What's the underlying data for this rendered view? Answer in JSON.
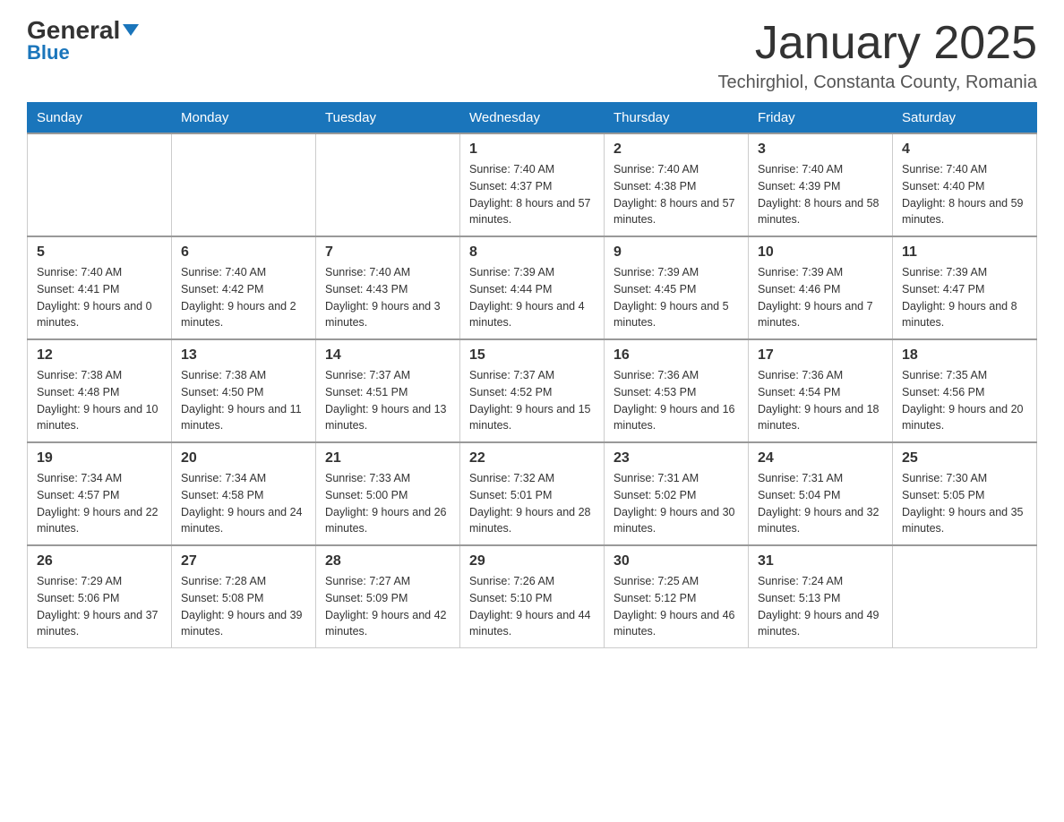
{
  "logo": {
    "general": "General",
    "blue": "Blue",
    "arrow": "▼"
  },
  "title": "January 2025",
  "subtitle": "Techirghiol, Constanta County, Romania",
  "days_of_week": [
    "Sunday",
    "Monday",
    "Tuesday",
    "Wednesday",
    "Thursday",
    "Friday",
    "Saturday"
  ],
  "weeks": [
    [
      {
        "day": "",
        "info": ""
      },
      {
        "day": "",
        "info": ""
      },
      {
        "day": "",
        "info": ""
      },
      {
        "day": "1",
        "info": "Sunrise: 7:40 AM\nSunset: 4:37 PM\nDaylight: 8 hours\nand 57 minutes."
      },
      {
        "day": "2",
        "info": "Sunrise: 7:40 AM\nSunset: 4:38 PM\nDaylight: 8 hours\nand 57 minutes."
      },
      {
        "day": "3",
        "info": "Sunrise: 7:40 AM\nSunset: 4:39 PM\nDaylight: 8 hours\nand 58 minutes."
      },
      {
        "day": "4",
        "info": "Sunrise: 7:40 AM\nSunset: 4:40 PM\nDaylight: 8 hours\nand 59 minutes."
      }
    ],
    [
      {
        "day": "5",
        "info": "Sunrise: 7:40 AM\nSunset: 4:41 PM\nDaylight: 9 hours\nand 0 minutes."
      },
      {
        "day": "6",
        "info": "Sunrise: 7:40 AM\nSunset: 4:42 PM\nDaylight: 9 hours\nand 2 minutes."
      },
      {
        "day": "7",
        "info": "Sunrise: 7:40 AM\nSunset: 4:43 PM\nDaylight: 9 hours\nand 3 minutes."
      },
      {
        "day": "8",
        "info": "Sunrise: 7:39 AM\nSunset: 4:44 PM\nDaylight: 9 hours\nand 4 minutes."
      },
      {
        "day": "9",
        "info": "Sunrise: 7:39 AM\nSunset: 4:45 PM\nDaylight: 9 hours\nand 5 minutes."
      },
      {
        "day": "10",
        "info": "Sunrise: 7:39 AM\nSunset: 4:46 PM\nDaylight: 9 hours\nand 7 minutes."
      },
      {
        "day": "11",
        "info": "Sunrise: 7:39 AM\nSunset: 4:47 PM\nDaylight: 9 hours\nand 8 minutes."
      }
    ],
    [
      {
        "day": "12",
        "info": "Sunrise: 7:38 AM\nSunset: 4:48 PM\nDaylight: 9 hours\nand 10 minutes."
      },
      {
        "day": "13",
        "info": "Sunrise: 7:38 AM\nSunset: 4:50 PM\nDaylight: 9 hours\nand 11 minutes."
      },
      {
        "day": "14",
        "info": "Sunrise: 7:37 AM\nSunset: 4:51 PM\nDaylight: 9 hours\nand 13 minutes."
      },
      {
        "day": "15",
        "info": "Sunrise: 7:37 AM\nSunset: 4:52 PM\nDaylight: 9 hours\nand 15 minutes."
      },
      {
        "day": "16",
        "info": "Sunrise: 7:36 AM\nSunset: 4:53 PM\nDaylight: 9 hours\nand 16 minutes."
      },
      {
        "day": "17",
        "info": "Sunrise: 7:36 AM\nSunset: 4:54 PM\nDaylight: 9 hours\nand 18 minutes."
      },
      {
        "day": "18",
        "info": "Sunrise: 7:35 AM\nSunset: 4:56 PM\nDaylight: 9 hours\nand 20 minutes."
      }
    ],
    [
      {
        "day": "19",
        "info": "Sunrise: 7:34 AM\nSunset: 4:57 PM\nDaylight: 9 hours\nand 22 minutes."
      },
      {
        "day": "20",
        "info": "Sunrise: 7:34 AM\nSunset: 4:58 PM\nDaylight: 9 hours\nand 24 minutes."
      },
      {
        "day": "21",
        "info": "Sunrise: 7:33 AM\nSunset: 5:00 PM\nDaylight: 9 hours\nand 26 minutes."
      },
      {
        "day": "22",
        "info": "Sunrise: 7:32 AM\nSunset: 5:01 PM\nDaylight: 9 hours\nand 28 minutes."
      },
      {
        "day": "23",
        "info": "Sunrise: 7:31 AM\nSunset: 5:02 PM\nDaylight: 9 hours\nand 30 minutes."
      },
      {
        "day": "24",
        "info": "Sunrise: 7:31 AM\nSunset: 5:04 PM\nDaylight: 9 hours\nand 32 minutes."
      },
      {
        "day": "25",
        "info": "Sunrise: 7:30 AM\nSunset: 5:05 PM\nDaylight: 9 hours\nand 35 minutes."
      }
    ],
    [
      {
        "day": "26",
        "info": "Sunrise: 7:29 AM\nSunset: 5:06 PM\nDaylight: 9 hours\nand 37 minutes."
      },
      {
        "day": "27",
        "info": "Sunrise: 7:28 AM\nSunset: 5:08 PM\nDaylight: 9 hours\nand 39 minutes."
      },
      {
        "day": "28",
        "info": "Sunrise: 7:27 AM\nSunset: 5:09 PM\nDaylight: 9 hours\nand 42 minutes."
      },
      {
        "day": "29",
        "info": "Sunrise: 7:26 AM\nSunset: 5:10 PM\nDaylight: 9 hours\nand 44 minutes."
      },
      {
        "day": "30",
        "info": "Sunrise: 7:25 AM\nSunset: 5:12 PM\nDaylight: 9 hours\nand 46 minutes."
      },
      {
        "day": "31",
        "info": "Sunrise: 7:24 AM\nSunset: 5:13 PM\nDaylight: 9 hours\nand 49 minutes."
      },
      {
        "day": "",
        "info": ""
      }
    ]
  ]
}
